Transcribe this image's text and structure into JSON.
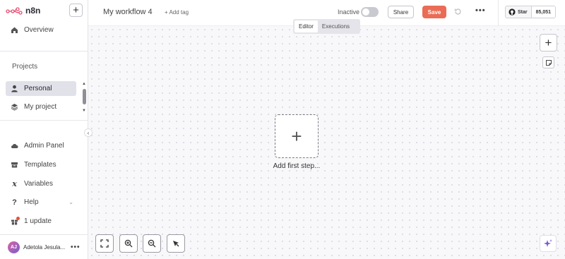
{
  "app": {
    "name": "n8n"
  },
  "sidebar": {
    "overview_label": "Overview",
    "projects_title": "Projects",
    "projects": [
      {
        "label": "Personal",
        "icon": "user-icon",
        "active": true
      },
      {
        "label": "My project",
        "icon": "layers-icon",
        "active": false
      }
    ],
    "bottom_items": [
      {
        "label": "Admin Panel",
        "icon": "cloud-icon"
      },
      {
        "label": "Templates",
        "icon": "box-icon"
      },
      {
        "label": "Variables",
        "icon": "variable-icon"
      },
      {
        "label": "Help",
        "icon": "question-icon"
      },
      {
        "label": "1 update",
        "icon": "gift-icon"
      }
    ],
    "user": {
      "initials": "AJ",
      "name": "Adetola Jesula..."
    }
  },
  "header": {
    "workflow_name": "My workflow 4",
    "add_tag": "+ Add tag",
    "status_label": "Inactive",
    "share_label": "Share",
    "save_label": "Save",
    "github": {
      "star_label": "Star",
      "star_count": "85,051"
    }
  },
  "tabs": {
    "editor": "Editor",
    "executions": "Executions"
  },
  "canvas": {
    "add_first_step": "Add first step..."
  },
  "colors": {
    "accent": "#ea6c55",
    "logo": "#ea4b71"
  }
}
